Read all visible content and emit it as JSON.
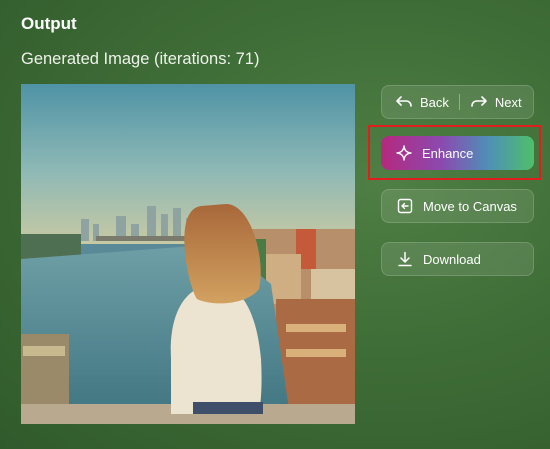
{
  "panel": {
    "title": "Output",
    "subtitle": "Generated Image (iterations: 71)"
  },
  "image": {
    "description_icon": "generated-image"
  },
  "actions": {
    "back_label": "Back",
    "next_label": "Next",
    "enhance_label": "Enhance",
    "move_label": "Move to Canvas",
    "download_label": "Download"
  },
  "colors": {
    "highlight": "#e01e1e",
    "enhance_gradient": [
      "#b5297e",
      "#8a4ab0",
      "#4f8fb8",
      "#4fbf6a"
    ]
  }
}
